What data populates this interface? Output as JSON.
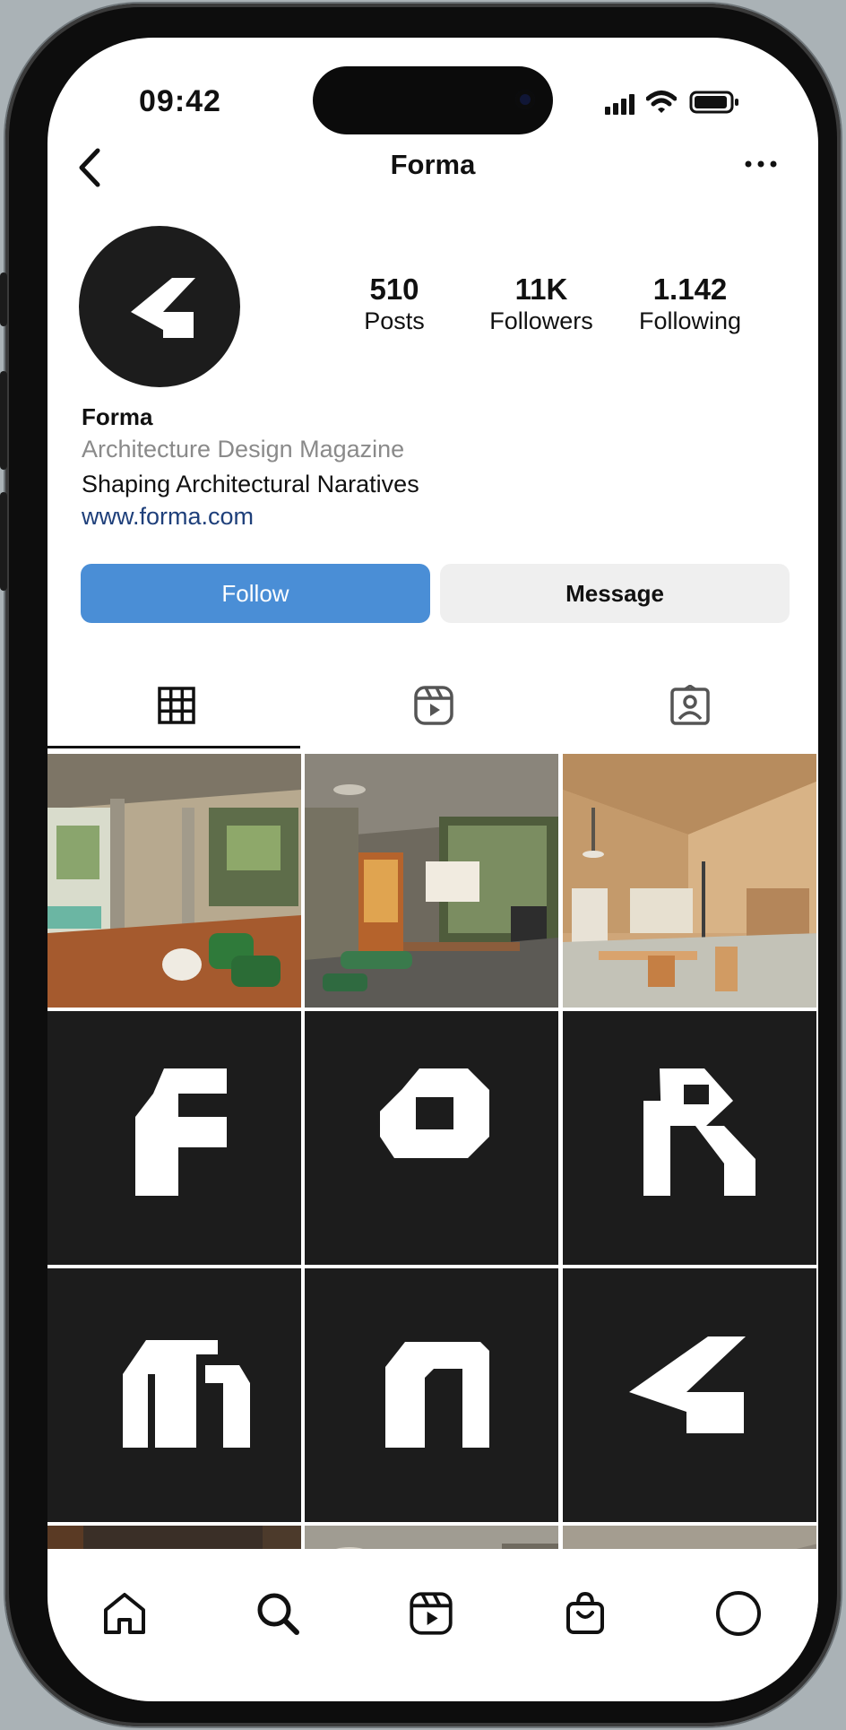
{
  "status_bar": {
    "time": "09:42"
  },
  "header": {
    "title": "Forma"
  },
  "profile": {
    "stats": [
      {
        "value": "510",
        "label": "Posts"
      },
      {
        "value": "11K",
        "label": "Followers"
      },
      {
        "value": "1.142",
        "label": "Following"
      }
    ],
    "name": "Forma",
    "category": "Architecture Design Magazine",
    "bio": "Shaping Architectural Naratives",
    "link": "www.forma.com"
  },
  "actions": {
    "follow_label": "Follow",
    "message_label": "Message"
  },
  "tabs": [
    {
      "icon": "grid-icon",
      "active": true
    },
    {
      "icon": "reels-icon",
      "active": false
    },
    {
      "icon": "tagged-icon",
      "active": false
    }
  ],
  "posts": [
    {
      "kind": "photo",
      "scene": "terrace"
    },
    {
      "kind": "photo",
      "scene": "dining-room"
    },
    {
      "kind": "photo",
      "scene": "wood-studio"
    },
    {
      "kind": "letter",
      "glyph": "F"
    },
    {
      "kind": "letter",
      "glyph": "O"
    },
    {
      "kind": "letter",
      "glyph": "R"
    },
    {
      "kind": "letter",
      "glyph": "M"
    },
    {
      "kind": "letter",
      "glyph": "A"
    },
    {
      "kind": "logo",
      "glyph": "<"
    },
    {
      "kind": "photo",
      "scene": "dark-wall"
    },
    {
      "kind": "photo",
      "scene": "concrete-ceiling"
    },
    {
      "kind": "photo",
      "scene": "concrete-roof"
    }
  ],
  "bottom_nav": [
    "home-icon",
    "search-icon",
    "reels-icon",
    "shop-icon",
    "profile-icon"
  ],
  "colors": {
    "accent": "#4a8ed6",
    "link": "#1e3f7a",
    "tile_dark": "#1c1c1c"
  }
}
